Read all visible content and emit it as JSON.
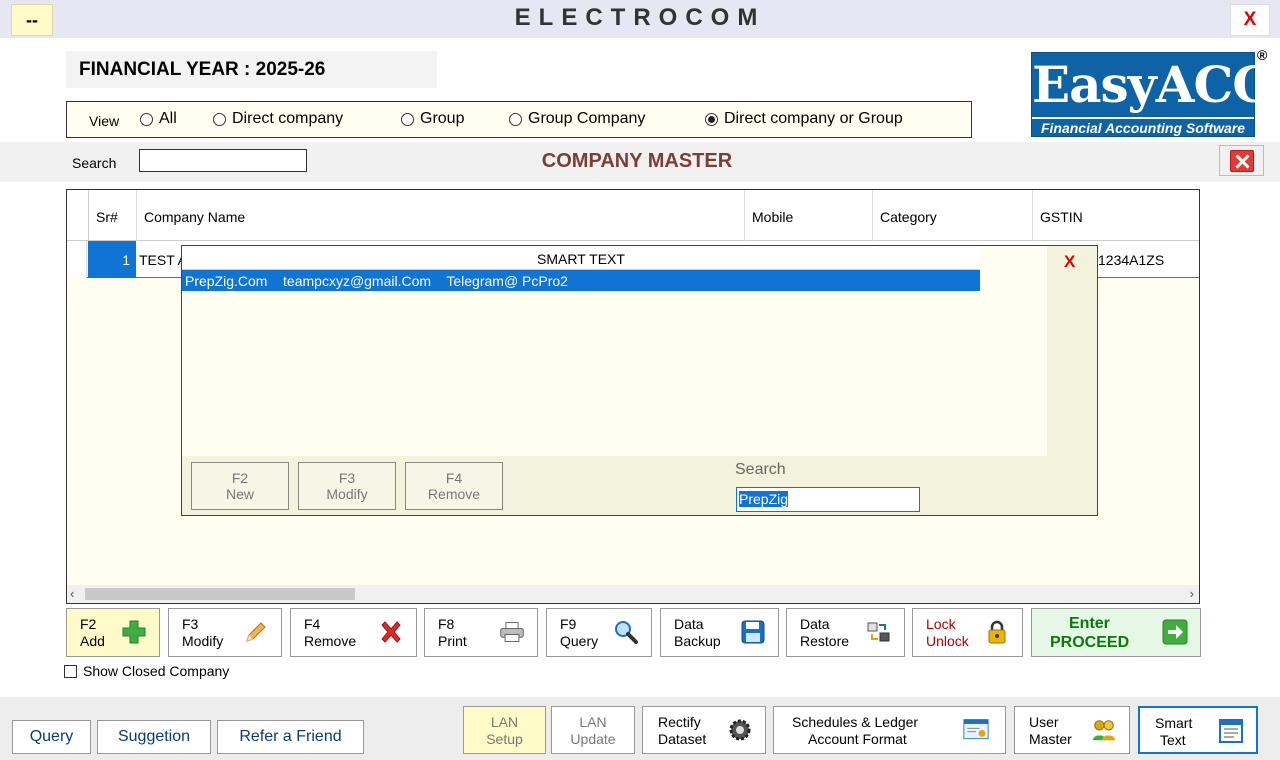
{
  "app": {
    "title": "ELECTROCOM",
    "menu_label": "--",
    "close_label": "X"
  },
  "financial_year": "FINANCIAL YEAR : 2025-26",
  "logo": {
    "main": "EasyACC",
    "sub": "Financial Accounting Software",
    "reg": "®"
  },
  "view": {
    "label": "View",
    "options": [
      {
        "label": "All",
        "selected": false
      },
      {
        "label": "Direct company",
        "selected": false
      },
      {
        "label": "Group",
        "selected": false
      },
      {
        "label": "Group Company",
        "selected": false
      },
      {
        "label": "Direct company or Group",
        "selected": true
      }
    ]
  },
  "search": {
    "label": "Search",
    "value": ""
  },
  "page_title": "COMPANY MASTER",
  "grid": {
    "columns": [
      "Sr#",
      "Company Name",
      "Mobile",
      "Category",
      "GSTIN"
    ],
    "rows": [
      {
        "sr": "1",
        "company": "TEST A",
        "mobile": "",
        "category": "",
        "gstin": "1234A1ZS"
      }
    ]
  },
  "smart_text": {
    "title": "SMART TEXT",
    "close_label": "X",
    "selected_row": "PrepZig.Com    teampcxyz@gmail.Com    Telegram@ PcPro2",
    "buttons": [
      {
        "key": "F2",
        "label": "New"
      },
      {
        "key": "F3",
        "label": "Modify"
      },
      {
        "key": "F4",
        "label": "Remove"
      }
    ],
    "search_label": "Search",
    "search_value": "PrepZig"
  },
  "toolbar": [
    {
      "key": "F2",
      "label": "Add",
      "icon": "plus-icon",
      "color": "#2e9c2e"
    },
    {
      "key": "F3",
      "label": "Modify",
      "icon": "pencil-icon",
      "color": "#e29b3a"
    },
    {
      "key": "F4",
      "label": "Remove",
      "icon": "x-icon",
      "color": "#d92020"
    },
    {
      "key": "F8",
      "label": "Print",
      "icon": "printer-icon",
      "color": "#666666"
    },
    {
      "key": "F9",
      "label": "Query",
      "icon": "magnifier-icon",
      "color": "#1b6fc4"
    },
    {
      "key": "Data",
      "label": "Backup",
      "icon": "floppy-icon",
      "color": "#1b6fc4"
    },
    {
      "key": "Data",
      "label": "Restore",
      "icon": "restore-icon",
      "color": "#555555"
    },
    {
      "key": "Lock",
      "label": "Unlock",
      "icon": "padlock-icon",
      "color": "#e0a800"
    },
    {
      "key": "Enter",
      "label": "PROCEED",
      "icon": "arrow-right-icon",
      "color": "#2e9c2e"
    }
  ],
  "show_closed_company": {
    "label": "Show Closed Company",
    "checked": false
  },
  "bottom": {
    "query": "Query",
    "suggestion": "Suggetion",
    "refer": "Refer a Friend",
    "lan_setup": [
      "LAN",
      "Setup"
    ],
    "lan_update": [
      "LAN",
      "Update"
    ],
    "rectify": [
      "Rectify",
      "Dataset"
    ],
    "schedules": [
      "Schedules & Ledger",
      "Account Format"
    ],
    "user_master": [
      "User",
      "Master"
    ],
    "smart_text": [
      "Smart",
      "Text"
    ]
  }
}
